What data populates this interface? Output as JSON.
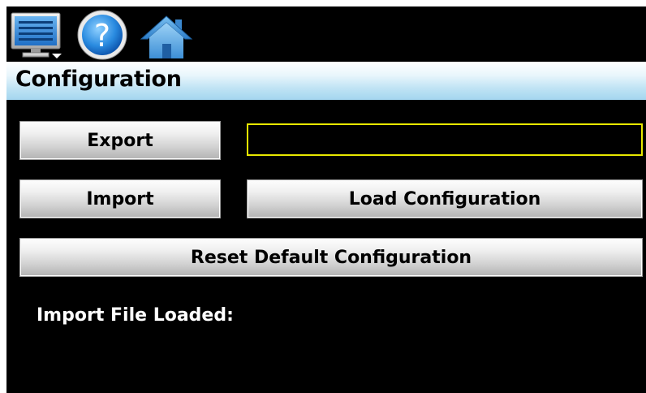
{
  "toolbar": {
    "menu_icon": "monitor-menu-icon",
    "help_icon": "help-icon",
    "home_icon": "home-icon",
    "help_glyph": "?"
  },
  "title_bar": {
    "title": "Configuration"
  },
  "buttons": {
    "export": "Export",
    "import": "Import",
    "load_configuration": "Load Configuration",
    "reset_default": "Reset Default Configuration"
  },
  "file_name_field": {
    "value": ""
  },
  "status": {
    "import_file_label": "Import File Loaded:"
  },
  "colors": {
    "background": "#000000",
    "title_bar_top": "#ffffff",
    "title_bar_bottom": "#a4d6ef",
    "field_border": "#e8e800",
    "button_top": "#fdfdfd",
    "button_bottom": "#b3b3b3"
  }
}
